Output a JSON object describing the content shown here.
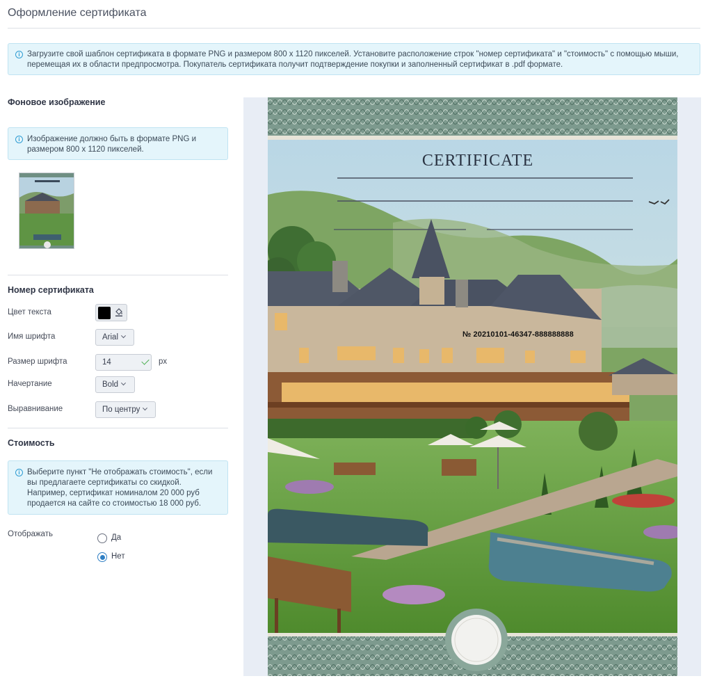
{
  "page": {
    "title": "Оформление сертификата",
    "info": "Загрузите свой шаблон сертификата в формате PNG и размером 800 x 1120 пикселей. Установите расположение строк \"номер сертификата\" и \"стоимость\" с помощью мыши, перемещая их в области предпросмотра. Покупатель сертификата получит подтверждение покупки и заполненный сертификат в .pdf формате."
  },
  "background": {
    "title": "Фоновое изображение",
    "info": "Изображение должно быть в формате PNG и размером 800 x 1120 пикселей."
  },
  "certificate_number": {
    "title": "Номер сертификата",
    "text_color_label": "Цвет текста",
    "text_color": "#000000",
    "font_name_label": "Имя шрифта",
    "font_name": "Arial",
    "font_size_label": "Размер шрифта",
    "font_size": "14",
    "font_size_unit": "px",
    "style_label": "Начертание",
    "style": "Bold",
    "align_label": "Выравнивание",
    "align": "По центру"
  },
  "price": {
    "title": "Стоимость",
    "info": "Выберите пункт \"Не отображать стоимость\", если вы предлагаете сертификаты со скидкой. Например, сертификат номиналом 20 000 руб продается на сайте со стоимостью 18 000 руб.",
    "display_label": "Отображать",
    "options": [
      "Да",
      "Нет"
    ],
    "selected": "Нет"
  },
  "preview": {
    "cert_title": "CERTIFICATE",
    "cert_number": "№ 20210101-46347-888888888"
  },
  "colors": {
    "accent": "#2f7fc4",
    "info_bg": "#e4f5fb",
    "preview_bg": "#e8edf5"
  }
}
